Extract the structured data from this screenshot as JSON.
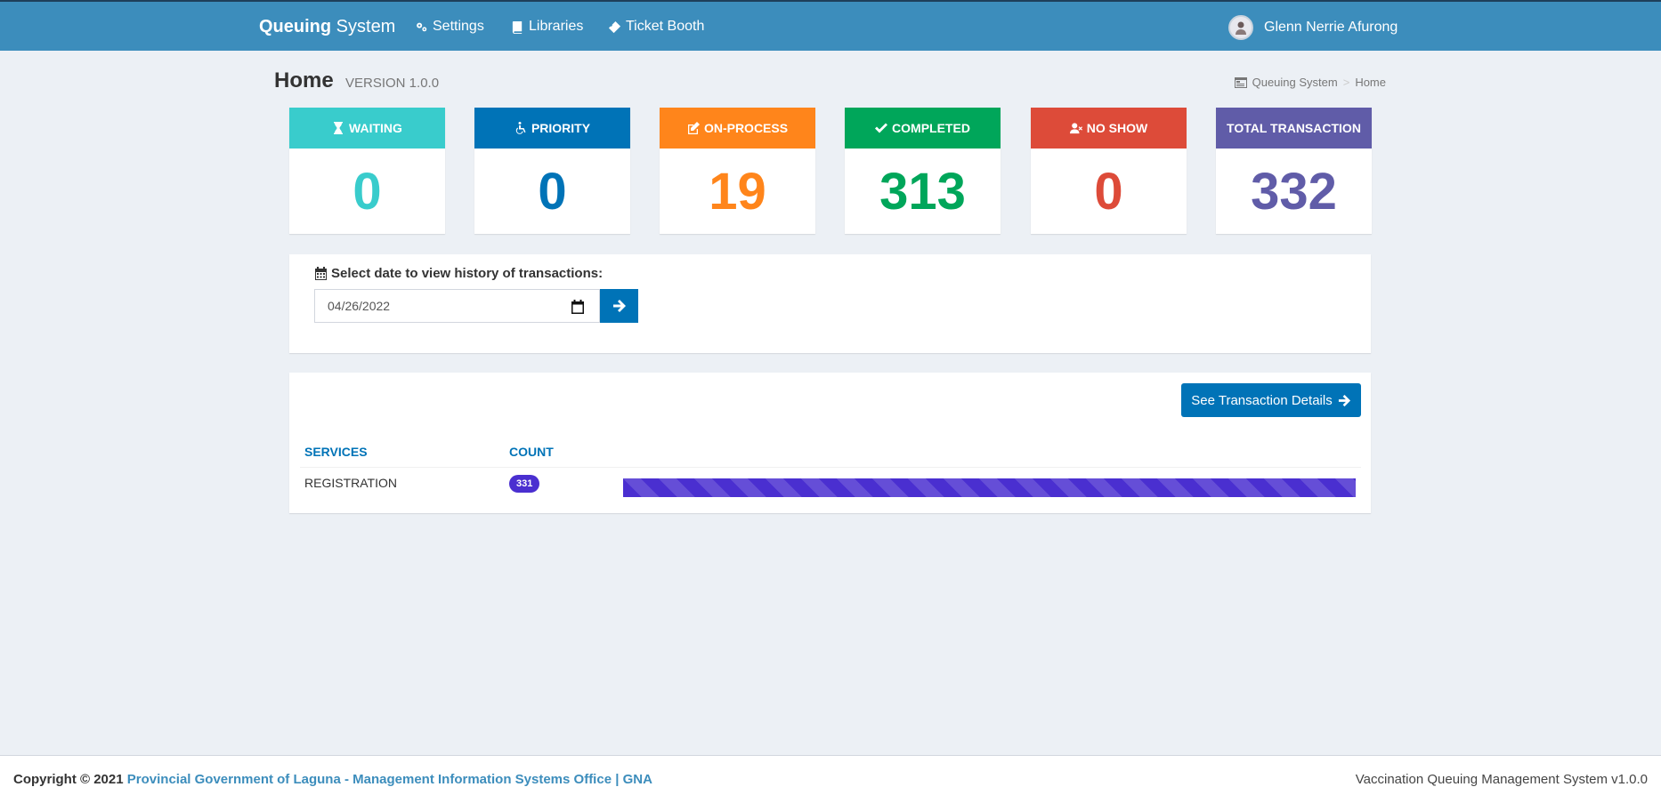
{
  "navbar": {
    "brand_bold": "Queuing",
    "brand_rest": " System",
    "items": [
      {
        "label": "Settings",
        "icon": "gears-icon"
      },
      {
        "label": "Libraries",
        "icon": "book-icon"
      },
      {
        "label": "Ticket Booth",
        "icon": "ticket-icon"
      }
    ],
    "user_name": "Glenn Nerrie Afurong"
  },
  "header": {
    "title": "Home",
    "version": "VERSION 1.0.0",
    "breadcrumb": [
      "Queuing System",
      "Home"
    ]
  },
  "stats": [
    {
      "label": "WAITING",
      "value": "0",
      "color": "#39cccc",
      "icon": "hourglass-icon"
    },
    {
      "label": "PRIORITY",
      "value": "0",
      "color": "#0073b7",
      "icon": "wheelchair-icon"
    },
    {
      "label": "ON-PROCESS",
      "value": "19",
      "color": "#ff851b",
      "icon": "edit-icon"
    },
    {
      "label": "COMPLETED",
      "value": "313",
      "color": "#00a65a",
      "icon": "check-icon"
    },
    {
      "label": "NO SHOW",
      "value": "0",
      "color": "#dd4b39",
      "icon": "user-times-icon"
    },
    {
      "label": "TOTAL TRANSACTION",
      "value": "332",
      "color": "#605ca8",
      "icon": ""
    }
  ],
  "history": {
    "label": "Select date to view history of transactions:",
    "date_value": "04/26/2022"
  },
  "services": {
    "details_button": "See Transaction Details",
    "col_services": "SERVICES",
    "col_count": "COUNT",
    "rows": [
      {
        "service": "REGISTRATION",
        "count": "331",
        "fraction": 1.0
      }
    ]
  },
  "footer": {
    "copyright": "Copyright © 2021",
    "org": "Provincial Government of Laguna - Management Information Systems Office | GNA",
    "app": "Vaccination Queuing Management System v1.0.0"
  }
}
